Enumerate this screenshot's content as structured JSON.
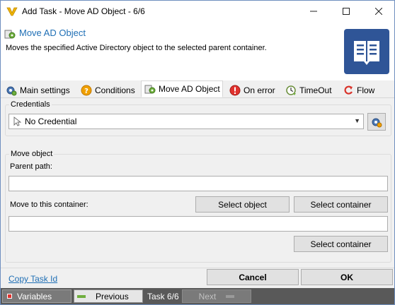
{
  "window": {
    "title": "Add Task - Move AD Object - 6/6",
    "controls": {
      "minimize": "minimize-icon",
      "maximize": "maximize-icon",
      "close": "close-icon"
    }
  },
  "header": {
    "task_name": "Move AD Object",
    "description": "Moves the specified Active Directory object to the selected parent container."
  },
  "tabs": [
    {
      "label": "Main settings",
      "icon": "gear-icon"
    },
    {
      "label": "Conditions",
      "icon": "question-icon"
    },
    {
      "label": "Move AD Object",
      "icon": "ad-object-icon",
      "active": true
    },
    {
      "label": "On error",
      "icon": "error-icon"
    },
    {
      "label": "TimeOut",
      "icon": "timeout-icon"
    },
    {
      "label": "Flow",
      "icon": "flow-icon"
    }
  ],
  "credentials": {
    "group_label": "Credentials",
    "selected": "No Credential"
  },
  "move_object": {
    "group_label": "Move object",
    "parent_path_label": "Parent path:",
    "parent_path_value": "",
    "container_label": "Move to this container:",
    "container_value": "",
    "select_object_label": "Select object",
    "select_container_label": "Select container",
    "select_container_label_2": "Select container"
  },
  "footer": {
    "copy_link": "Copy Task Id",
    "cancel_label": "Cancel",
    "ok_label": "OK"
  },
  "statusbar": {
    "variables_label": "Variables",
    "previous_label": "Previous",
    "task_counter": "Task 6/6",
    "next_label": "Next"
  },
  "colors": {
    "accent": "#1f6fb5",
    "big_icon_bg": "#2f5597",
    "statusbar_bg": "#595959"
  }
}
